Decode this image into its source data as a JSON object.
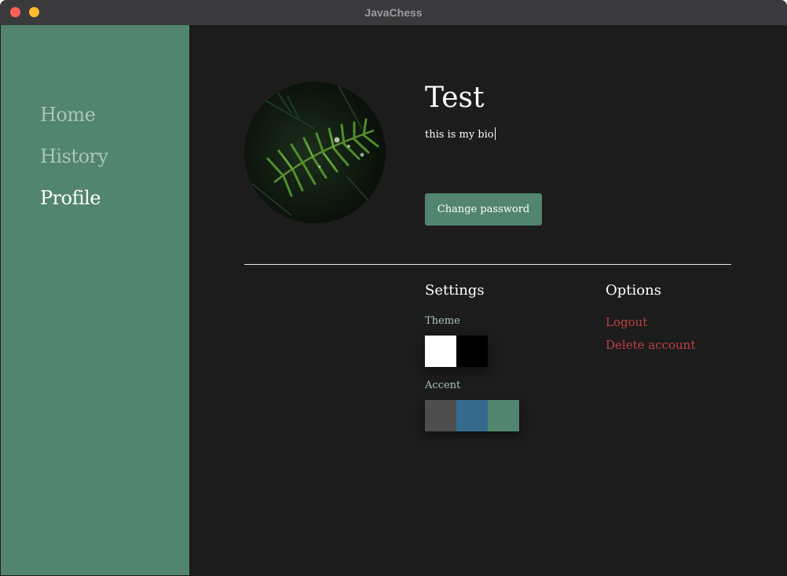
{
  "window": {
    "title": "JavaChess"
  },
  "sidebar": {
    "items": [
      {
        "label": "Home",
        "active": false
      },
      {
        "label": "History",
        "active": false
      },
      {
        "label": "Profile",
        "active": true
      }
    ]
  },
  "profile": {
    "username": "Test",
    "bio": "this is my bio",
    "avatar": "fern-leaves-photo",
    "change_password_label": "Change password"
  },
  "settings": {
    "title": "Settings",
    "theme_label": "Theme",
    "theme_colors": [
      "#ffffff",
      "#000000"
    ],
    "accent_label": "Accent",
    "accent_colors": [
      "#4d4d4d",
      "#346b8d",
      "#52856f"
    ]
  },
  "options": {
    "title": "Options",
    "logout_label": "Logout",
    "delete_label": "Delete account"
  },
  "colors": {
    "sidebar": "#52856f",
    "background": "#1c1c1c",
    "danger": "#c0413f"
  }
}
